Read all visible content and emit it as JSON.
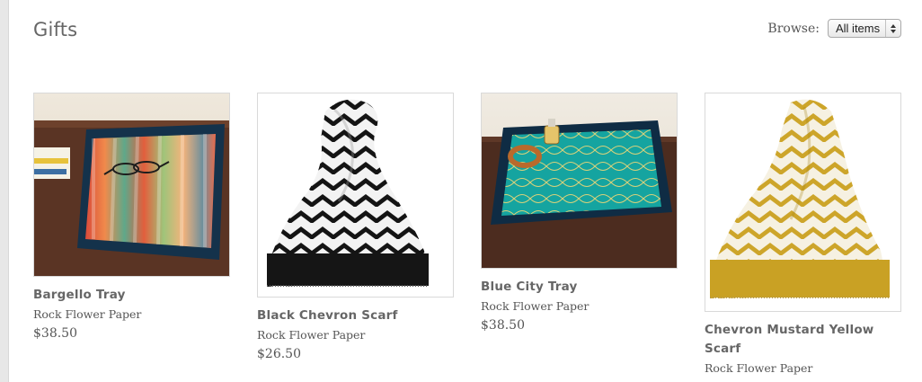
{
  "page": {
    "title": "Gifts"
  },
  "browse": {
    "label": "Browse:",
    "selected": "All items"
  },
  "products": [
    {
      "name": "Bargello Tray",
      "maker": "Rock Flower Paper",
      "price": "$38.50",
      "image_icon": "bargello-tray-image"
    },
    {
      "name": "Black Chevron Scarf",
      "maker": "Rock Flower Paper",
      "price": "$26.50",
      "image_icon": "black-chevron-scarf-image"
    },
    {
      "name": "Blue City Tray",
      "maker": "Rock Flower Paper",
      "price": "$38.50",
      "image_icon": "blue-city-tray-image"
    },
    {
      "name": "Chevron Mustard Yellow Scarf",
      "maker": "Rock Flower Paper",
      "price": "",
      "image_icon": "chevron-mustard-scarf-image"
    }
  ],
  "colors": {
    "title": "#666666",
    "tray_dark": "#13334a",
    "teal": "#19a3a0",
    "mustard": "#cfa623",
    "scarf_black": "#111111"
  }
}
